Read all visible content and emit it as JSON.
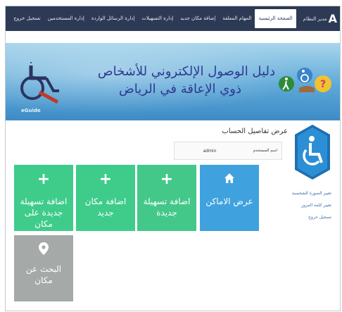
{
  "nav": {
    "brand_letter": "A",
    "brand_text": "مدير النظام",
    "items": [
      {
        "label": "الصفحة الرئيسية",
        "active": true
      },
      {
        "label": "المهام المعلقة",
        "active": false
      },
      {
        "label": "إضافة مكان جديد",
        "active": false
      },
      {
        "label": "إدارة التسهيلات",
        "active": false
      },
      {
        "label": "إدارة الرسائل الواردة",
        "active": false
      },
      {
        "label": "إدارة المستخدمين",
        "active": false
      },
      {
        "label": "تسجيل خروج",
        "active": false
      }
    ]
  },
  "banner": {
    "title": "دليل الوصول الإلكتروني للأشخاص",
    "subtitle": "ذوي الإعاقة في الرياض",
    "logo_text": "eGuide"
  },
  "account": {
    "heading": "عرض تفاصيل الحساب",
    "username_label": "اسم المستخدم",
    "username_value": "admin"
  },
  "side_links": [
    "تغيير الصورة الشخصية",
    "تغيير كلمة المرور",
    "تسجيل خروج"
  ],
  "tiles": [
    {
      "label": "عرض الاماكن",
      "icon": "home-icon",
      "color": "#3fa2de"
    },
    {
      "label": "اضافة تسهيلة جديدة",
      "icon": "plus-icon",
      "color": "#44c88a"
    },
    {
      "label": "اضافة مكان جديد",
      "icon": "plus-icon",
      "color": "#3fcc8b"
    },
    {
      "label": "اضافة تسهيلة جديدة على مكان",
      "icon": "plus-icon",
      "color": "#3fcc8b"
    },
    {
      "label": "البحث عن مكان",
      "icon": "map-pin-icon",
      "color": "#a5a9a8"
    }
  ]
}
